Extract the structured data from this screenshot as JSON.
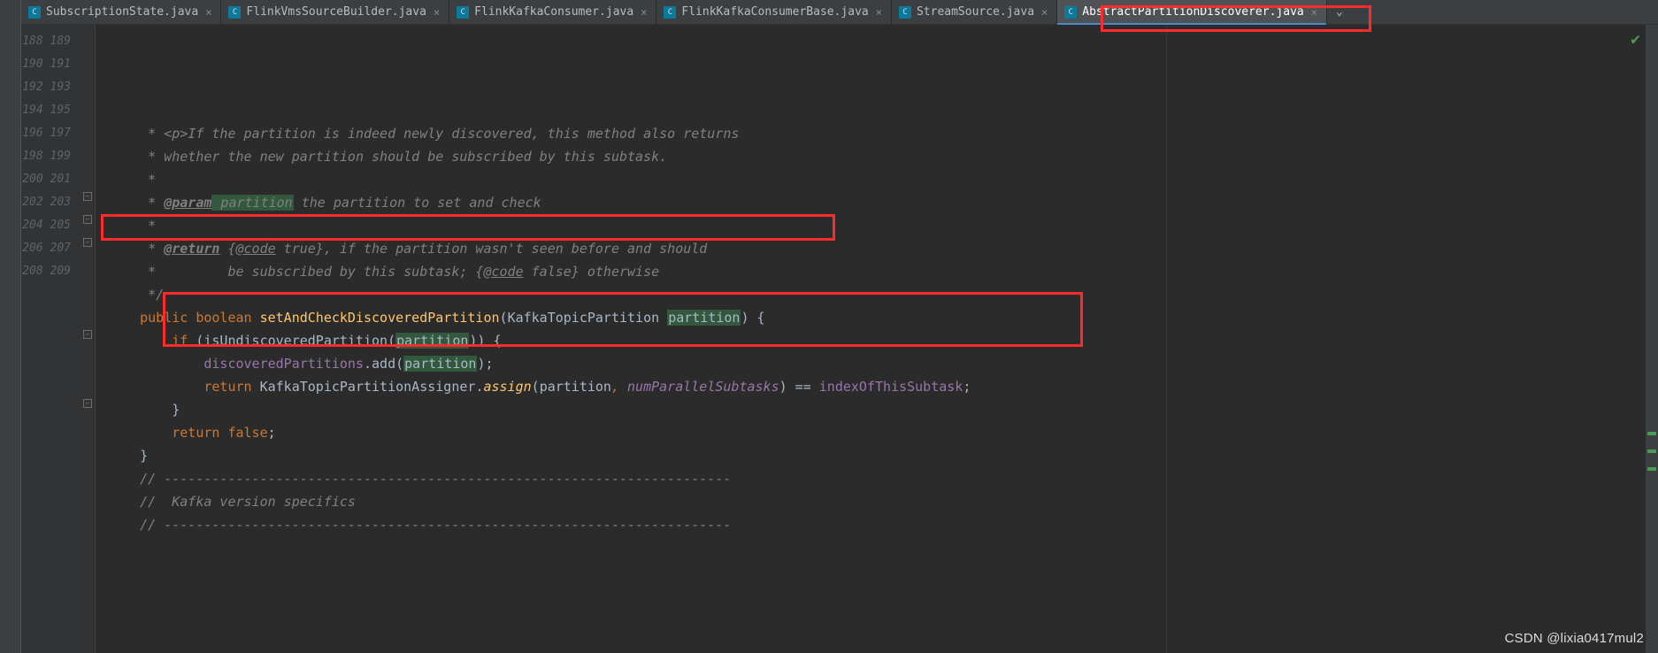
{
  "tabs": [
    {
      "label": "SubscriptionState.java"
    },
    {
      "label": "FlinkVmsSourceBuilder.java"
    },
    {
      "label": "FlinkKafkaConsumer.java"
    },
    {
      "label": "FlinkKafkaConsumerBase.java"
    },
    {
      "label": "StreamSource.java"
    },
    {
      "label": "AbstractPartitionDiscoverer.java"
    }
  ],
  "active_tab_index": 5,
  "line_start": 188,
  "line_end": 209,
  "current_line": 200,
  "code_tokens": {
    "l188": {
      "pre": "     * ",
      "tag": "<p>",
      "rest": "If the partition is indeed newly discovered, this method also returns"
    },
    "l189": "     * whether the new partition should be subscribed by this subtask.",
    "l190": "     *",
    "l191": {
      "pre": "     * ",
      "tag": "@param",
      "param": " partition",
      "rest": " the partition to set and check"
    },
    "l192": "     *",
    "l193": {
      "pre": "     * ",
      "tag": "@return",
      "rest1": " {",
      "code": "@code",
      "rest2": " true}, if the partition wasn't seen before and should"
    },
    "l194": {
      "pre": "     *         be subscribed by this subtask; {",
      "code": "@code",
      "rest": " false} otherwise"
    },
    "l195": "     */",
    "l196": {
      "kw1": "public",
      "kw2": "boolean",
      "method": "setAndCheckDiscoveredPartition",
      "type": "KafkaTopicPartition",
      "param": "partition"
    },
    "l197": {
      "kw": "if",
      "call": "isUndiscoveredPartition",
      "param": "partition"
    },
    "l198": {
      "field": "discoveredPartitions",
      "call": "add",
      "param": "partition"
    },
    "l200": {
      "kw": "return",
      "cls": "KafkaTopicPartitionAssigner",
      "call": "assign",
      "p1": "partition",
      "p2": "numParallelSubtasks",
      "rhs": "indexOfThisSubtask"
    },
    "l203": {
      "kw": "return",
      "val": "false"
    },
    "l206": "    // -----------------------------------------------------------------------",
    "l207": "    //  Kafka version specifics",
    "l208": "    // -----------------------------------------------------------------------"
  },
  "watermark": "CSDN @lixia0417mul2",
  "icons": {
    "java": "C",
    "close": "×",
    "more": "⌄",
    "ok": "✔"
  }
}
